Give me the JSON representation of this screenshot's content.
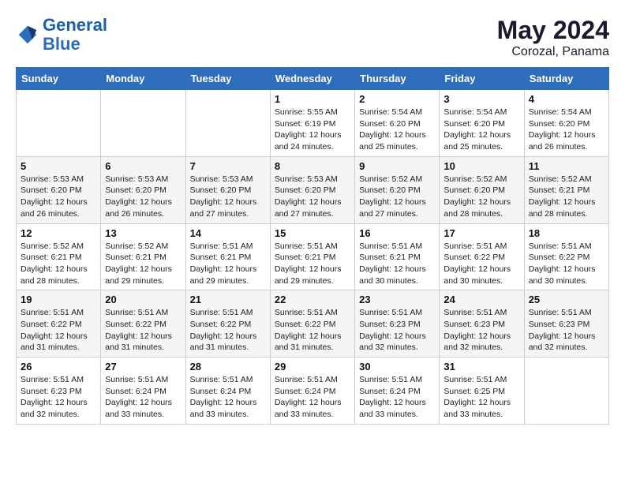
{
  "header": {
    "logo_line1": "General",
    "logo_line2": "Blue",
    "month": "May 2024",
    "location": "Corozal, Panama"
  },
  "days_of_week": [
    "Sunday",
    "Monday",
    "Tuesday",
    "Wednesday",
    "Thursday",
    "Friday",
    "Saturday"
  ],
  "weeks": [
    [
      {
        "day": "",
        "info": ""
      },
      {
        "day": "",
        "info": ""
      },
      {
        "day": "",
        "info": ""
      },
      {
        "day": "1",
        "info": "Sunrise: 5:55 AM\nSunset: 6:19 PM\nDaylight: 12 hours and 24 minutes."
      },
      {
        "day": "2",
        "info": "Sunrise: 5:54 AM\nSunset: 6:20 PM\nDaylight: 12 hours and 25 minutes."
      },
      {
        "day": "3",
        "info": "Sunrise: 5:54 AM\nSunset: 6:20 PM\nDaylight: 12 hours and 25 minutes."
      },
      {
        "day": "4",
        "info": "Sunrise: 5:54 AM\nSunset: 6:20 PM\nDaylight: 12 hours and 26 minutes."
      }
    ],
    [
      {
        "day": "5",
        "info": "Sunrise: 5:53 AM\nSunset: 6:20 PM\nDaylight: 12 hours and 26 minutes."
      },
      {
        "day": "6",
        "info": "Sunrise: 5:53 AM\nSunset: 6:20 PM\nDaylight: 12 hours and 26 minutes."
      },
      {
        "day": "7",
        "info": "Sunrise: 5:53 AM\nSunset: 6:20 PM\nDaylight: 12 hours and 27 minutes."
      },
      {
        "day": "8",
        "info": "Sunrise: 5:53 AM\nSunset: 6:20 PM\nDaylight: 12 hours and 27 minutes."
      },
      {
        "day": "9",
        "info": "Sunrise: 5:52 AM\nSunset: 6:20 PM\nDaylight: 12 hours and 27 minutes."
      },
      {
        "day": "10",
        "info": "Sunrise: 5:52 AM\nSunset: 6:20 PM\nDaylight: 12 hours and 28 minutes."
      },
      {
        "day": "11",
        "info": "Sunrise: 5:52 AM\nSunset: 6:21 PM\nDaylight: 12 hours and 28 minutes."
      }
    ],
    [
      {
        "day": "12",
        "info": "Sunrise: 5:52 AM\nSunset: 6:21 PM\nDaylight: 12 hours and 28 minutes."
      },
      {
        "day": "13",
        "info": "Sunrise: 5:52 AM\nSunset: 6:21 PM\nDaylight: 12 hours and 29 minutes."
      },
      {
        "day": "14",
        "info": "Sunrise: 5:51 AM\nSunset: 6:21 PM\nDaylight: 12 hours and 29 minutes."
      },
      {
        "day": "15",
        "info": "Sunrise: 5:51 AM\nSunset: 6:21 PM\nDaylight: 12 hours and 29 minutes."
      },
      {
        "day": "16",
        "info": "Sunrise: 5:51 AM\nSunset: 6:21 PM\nDaylight: 12 hours and 30 minutes."
      },
      {
        "day": "17",
        "info": "Sunrise: 5:51 AM\nSunset: 6:22 PM\nDaylight: 12 hours and 30 minutes."
      },
      {
        "day": "18",
        "info": "Sunrise: 5:51 AM\nSunset: 6:22 PM\nDaylight: 12 hours and 30 minutes."
      }
    ],
    [
      {
        "day": "19",
        "info": "Sunrise: 5:51 AM\nSunset: 6:22 PM\nDaylight: 12 hours and 31 minutes."
      },
      {
        "day": "20",
        "info": "Sunrise: 5:51 AM\nSunset: 6:22 PM\nDaylight: 12 hours and 31 minutes."
      },
      {
        "day": "21",
        "info": "Sunrise: 5:51 AM\nSunset: 6:22 PM\nDaylight: 12 hours and 31 minutes."
      },
      {
        "day": "22",
        "info": "Sunrise: 5:51 AM\nSunset: 6:22 PM\nDaylight: 12 hours and 31 minutes."
      },
      {
        "day": "23",
        "info": "Sunrise: 5:51 AM\nSunset: 6:23 PM\nDaylight: 12 hours and 32 minutes."
      },
      {
        "day": "24",
        "info": "Sunrise: 5:51 AM\nSunset: 6:23 PM\nDaylight: 12 hours and 32 minutes."
      },
      {
        "day": "25",
        "info": "Sunrise: 5:51 AM\nSunset: 6:23 PM\nDaylight: 12 hours and 32 minutes."
      }
    ],
    [
      {
        "day": "26",
        "info": "Sunrise: 5:51 AM\nSunset: 6:23 PM\nDaylight: 12 hours and 32 minutes."
      },
      {
        "day": "27",
        "info": "Sunrise: 5:51 AM\nSunset: 6:24 PM\nDaylight: 12 hours and 33 minutes."
      },
      {
        "day": "28",
        "info": "Sunrise: 5:51 AM\nSunset: 6:24 PM\nDaylight: 12 hours and 33 minutes."
      },
      {
        "day": "29",
        "info": "Sunrise: 5:51 AM\nSunset: 6:24 PM\nDaylight: 12 hours and 33 minutes."
      },
      {
        "day": "30",
        "info": "Sunrise: 5:51 AM\nSunset: 6:24 PM\nDaylight: 12 hours and 33 minutes."
      },
      {
        "day": "31",
        "info": "Sunrise: 5:51 AM\nSunset: 6:25 PM\nDaylight: 12 hours and 33 minutes."
      },
      {
        "day": "",
        "info": ""
      }
    ]
  ]
}
